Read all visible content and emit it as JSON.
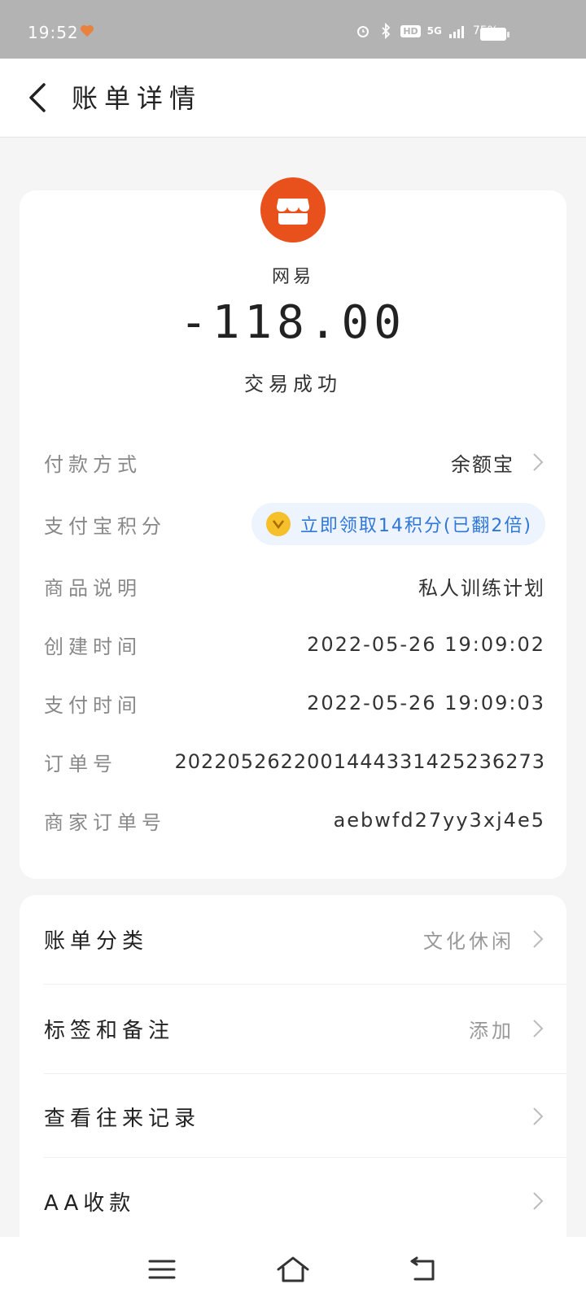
{
  "status_bar": {
    "time": "19:52",
    "network": "5G",
    "hd": "HD",
    "battery": "75%"
  },
  "header": {
    "title": "账单详情"
  },
  "summary": {
    "merchant": "网易",
    "amount": "-118.00",
    "status": "交易成功"
  },
  "details": [
    {
      "label": "付款方式",
      "value": "余额宝"
    },
    {
      "label": "支付宝积分",
      "value": "立即领取14积分(已翻2倍)"
    },
    {
      "label": "商品说明",
      "value": "私人训练计划"
    },
    {
      "label": "创建时间",
      "value": "2022-05-26 19:09:02"
    },
    {
      "label": "支付时间",
      "value": "2022-05-26 19:09:03"
    },
    {
      "label": "订单号",
      "value": "2022052622001444331425236273"
    },
    {
      "label": "商家订单号",
      "value": "aebwfd27yy3xj4e5"
    }
  ],
  "actions": [
    {
      "label": "账单分类",
      "value": "文化休闲"
    },
    {
      "label": "标签和备注",
      "value": "添加"
    },
    {
      "label": "查看往来记录",
      "value": ""
    },
    {
      "label": "AA收款",
      "value": ""
    }
  ],
  "colors": {
    "brand_orange": "#e8511c",
    "link_blue": "#2f77d8",
    "status_bar_gray": "#b3b3b3"
  }
}
